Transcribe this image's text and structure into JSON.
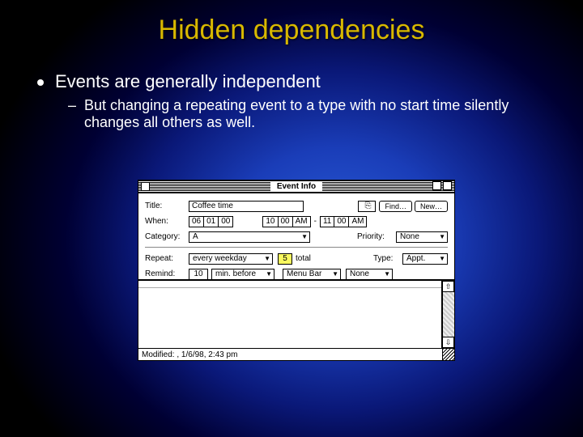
{
  "slide": {
    "title": "Hidden dependencies",
    "bullet": "Events are generally independent",
    "sub_bullet": "But changing a repeating event to a type with no start time silently changes all others as well."
  },
  "dialog": {
    "window_title": "Event Info",
    "labels": {
      "title": "Title:",
      "when": "When:",
      "category": "Category:",
      "priority": "Priority:",
      "repeat": "Repeat:",
      "total": "total",
      "type": "Type:",
      "remind": "Remind:"
    },
    "values": {
      "title": "Coffee time",
      "date": {
        "month": "06",
        "day": "01",
        "year": "00"
      },
      "start": {
        "hour": "10",
        "minute": "00",
        "ampm": "AM"
      },
      "end": {
        "hour": "11",
        "minute": "00",
        "ampm": "AM"
      },
      "category": "A",
      "priority": "None",
      "repeat": "every weekday",
      "repeat_count": "5",
      "type": "Appt.",
      "remind_value": "10",
      "remind_unit": "min. before",
      "remind_target": "Menu Bar",
      "remind_sound": "None"
    },
    "buttons": {
      "link_icon": "⎘",
      "find": "Find…",
      "new": "New…"
    },
    "status": "Modified: , 1/6/98, 2:43 pm"
  }
}
